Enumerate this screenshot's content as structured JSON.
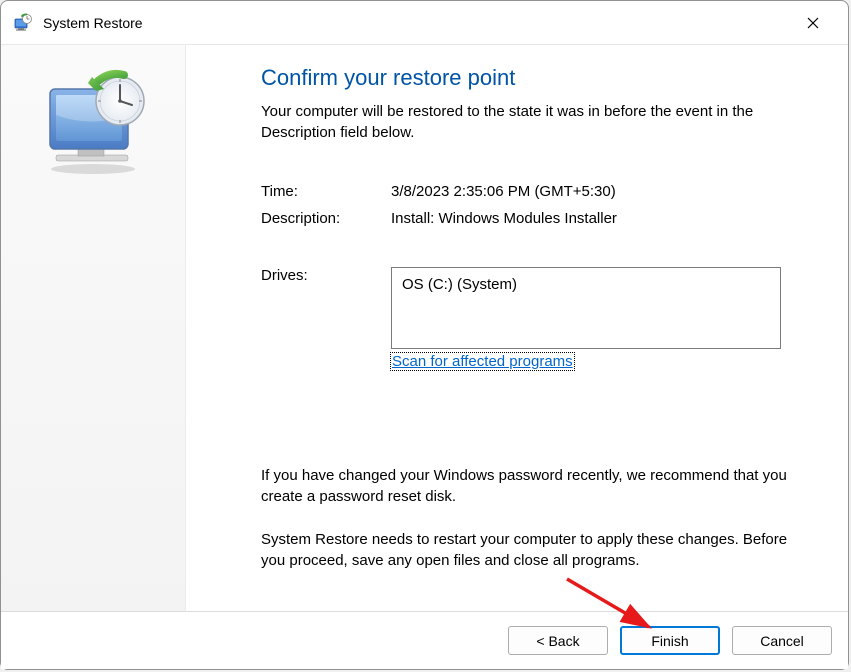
{
  "titlebar": {
    "title": "System Restore"
  },
  "content": {
    "heading": "Confirm your restore point",
    "subheading": "Your computer will be restored to the state it was in before the event in the Description field below.",
    "time_label": "Time:",
    "time_value": "3/8/2023 2:35:06 PM (GMT+5:30)",
    "description_label": "Description:",
    "description_value": "Install: Windows Modules Installer",
    "drives_label": "Drives:",
    "drives_value": "OS (C:) (System)",
    "scan_link": "Scan for affected programs",
    "password_note": "If you have changed your Windows password recently, we recommend that you create a password reset disk.",
    "restart_note": "System Restore needs to restart your computer to apply these changes. Before you proceed, save any open files and close all programs."
  },
  "buttons": {
    "back": "< Back",
    "finish": "Finish",
    "cancel": "Cancel"
  }
}
